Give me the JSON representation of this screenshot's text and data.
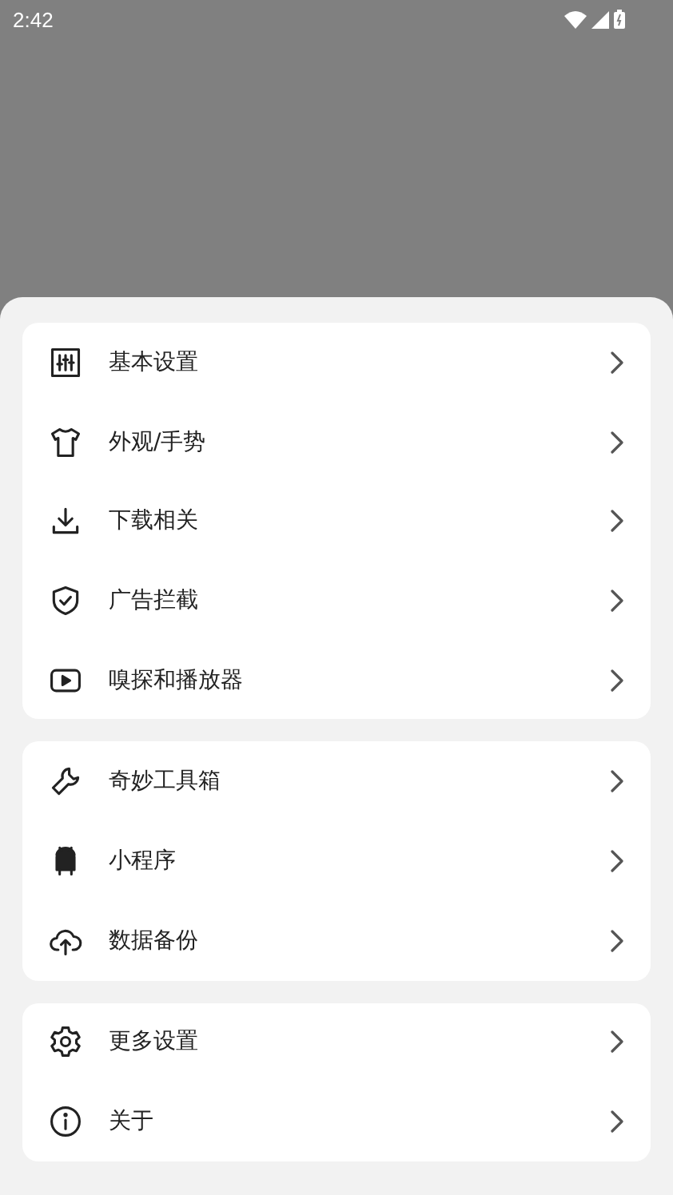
{
  "status_bar": {
    "time": "2:42"
  },
  "groups": [
    {
      "items": [
        {
          "label": "基本设置"
        },
        {
          "label": "外观/手势"
        },
        {
          "label": "下载相关"
        },
        {
          "label": "广告拦截"
        },
        {
          "label": "嗅探和播放器"
        }
      ]
    },
    {
      "items": [
        {
          "label": "奇妙工具箱"
        },
        {
          "label": "小程序"
        },
        {
          "label": "数据备份"
        }
      ]
    },
    {
      "items": [
        {
          "label": "更多设置"
        },
        {
          "label": "关于"
        }
      ]
    }
  ]
}
